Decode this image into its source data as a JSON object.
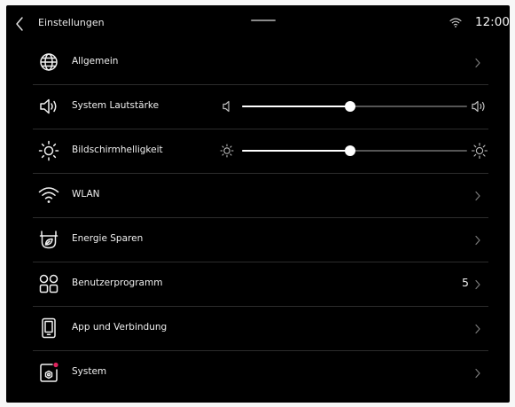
{
  "header": {
    "back_icon": "chevron-left-icon",
    "title": "Einstellungen"
  },
  "status": {
    "wifi_icon": "wifi-icon",
    "time": "12:00"
  },
  "rows": [
    {
      "icon": "globe-icon",
      "label": "Allgemein",
      "trailing": "chevron"
    },
    {
      "icon": "speaker-icon",
      "label": "System Lautstärke",
      "trailing": "slider",
      "slider_value": 0.48
    },
    {
      "icon": "sun-icon",
      "label": "Bildschirmhelligkeit",
      "trailing": "slider",
      "slider_value": 0.48
    },
    {
      "icon": "wifi-icon",
      "label": "WLAN",
      "trailing": "chevron"
    },
    {
      "icon": "eco-leaf-icon",
      "label": "Energie Sparen",
      "trailing": "chevron"
    },
    {
      "icon": "apps-grid-icon",
      "label": "Benutzerprogramm",
      "trailing": "chevron",
      "count": "5"
    },
    {
      "icon": "phone-device-icon",
      "label": "App und Verbindung",
      "trailing": "chevron"
    },
    {
      "icon": "system-update-icon",
      "label": "System",
      "trailing": "chevron",
      "badge_color": "#e0245e"
    }
  ],
  "colors": {
    "background": "#000000",
    "text": "#f0f0f0",
    "divider": "#2c2c2c",
    "slider_track": "#555555",
    "badge": "#e0245e"
  }
}
